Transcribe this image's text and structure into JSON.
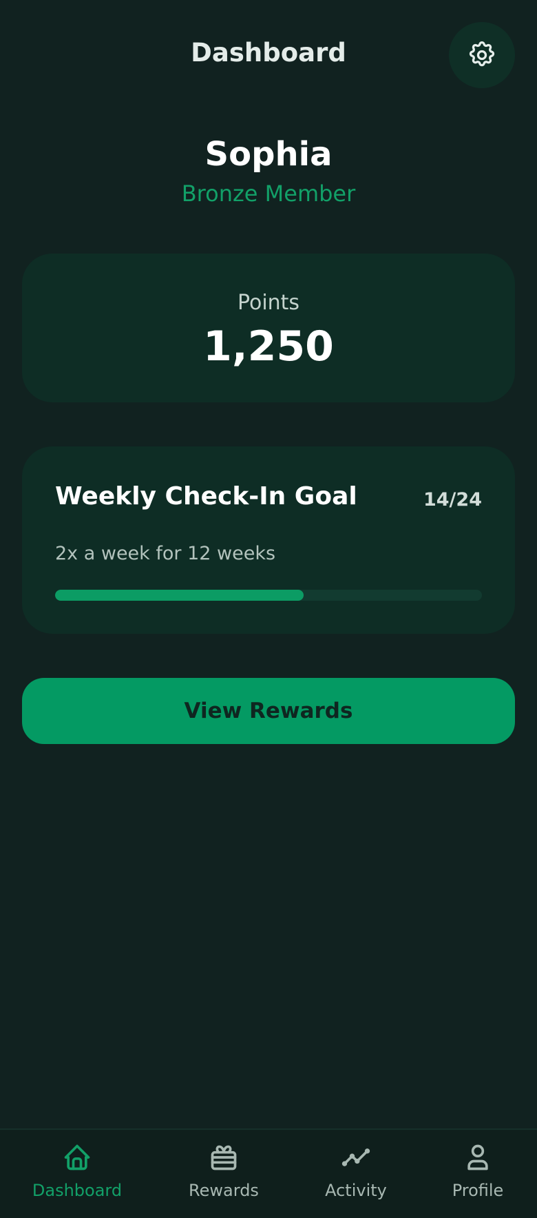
{
  "header": {
    "title": "Dashboard",
    "settings_icon": "gear-icon"
  },
  "user": {
    "name": "Sophia",
    "tier": "Bronze Member"
  },
  "points": {
    "label": "Points",
    "value": "1,250"
  },
  "goal": {
    "title": "Weekly Check-In Goal",
    "count": "14/24",
    "description": "2x a week for 12 weeks",
    "progress": 0.583
  },
  "cta": {
    "label": "View Rewards"
  },
  "nav": {
    "items": [
      {
        "label": "Dashboard",
        "icon": "home-icon",
        "active": true
      },
      {
        "label": "Rewards",
        "icon": "gift-icon",
        "active": false
      },
      {
        "label": "Activity",
        "icon": "activity-icon",
        "active": false
      },
      {
        "label": "Profile",
        "icon": "user-icon",
        "active": false
      }
    ]
  },
  "colors": {
    "background": "#112220",
    "card": "#0e2d25",
    "accent": "#049a63",
    "tier_text": "#12a068"
  }
}
